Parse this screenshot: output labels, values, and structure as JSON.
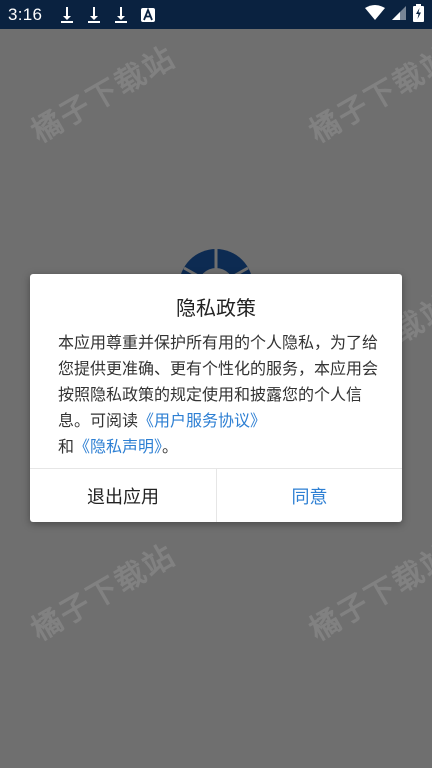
{
  "status_bar": {
    "time": "3:16",
    "icons": [
      "download-icon",
      "download-icon",
      "download-icon",
      "a-app-icon",
      "wifi-icon",
      "signal-icon",
      "battery-icon"
    ]
  },
  "watermark": {
    "text": "橘子下载站"
  },
  "dialog": {
    "title": "隐私政策",
    "body_text": "本应用尊重并保护所有用的个人隐私，为了给您提供更准确、更有个性化的服务，本应用会按照隐私政策的规定使用和披露您的个人信息。可阅读",
    "link_service": "《用户服务协议》",
    "and_text": "和",
    "link_privacy": "《隐私声明》",
    "end_text": "。",
    "exit_button": "退出应用",
    "agree_button": "同意"
  },
  "colors": {
    "status_bar_bg": "#0a2240",
    "overlay_bg": "#6f6f6f",
    "link": "#2d7fd3",
    "logo": "#0d2b52"
  }
}
